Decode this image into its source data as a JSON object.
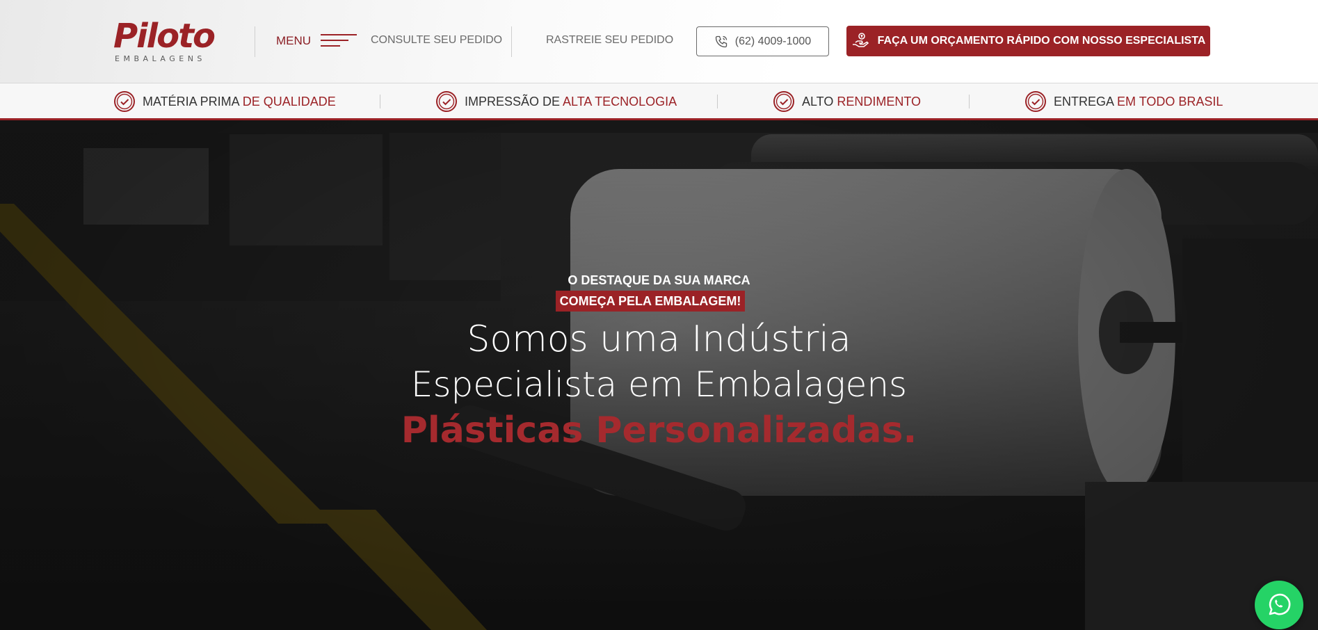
{
  "brand": {
    "name": "Piloto",
    "subtitle": "EMBALAGENS",
    "color": "#9b2226"
  },
  "header": {
    "menu_label": "MENU",
    "nav": [
      {
        "label": "CONSULTE SEU PEDIDO"
      },
      {
        "label": "RASTREIE SEU PEDIDO"
      }
    ],
    "phone": {
      "label": "(62) 4009-1000",
      "icon": "phone-icon"
    },
    "cta": {
      "label": "FAÇA UM ORÇAMENTO RÁPIDO COM NOSSO ESPECIALISTA",
      "icon": "hand-coins-icon"
    }
  },
  "features": [
    {
      "text": "MATÉRIA PRIMA ",
      "highlight": "DE QUALIDADE",
      "icon": "check-circle-icon"
    },
    {
      "text": "IMPRESSÃO DE ",
      "highlight": "ALTA TECNOLOGIA",
      "icon": "check-circle-icon"
    },
    {
      "text": "ALTO ",
      "highlight": "RENDIMENTO",
      "icon": "check-circle-icon"
    },
    {
      "text": "ENTREGA ",
      "highlight": "EM TODO BRASIL",
      "icon": "check-circle-icon"
    }
  ],
  "hero": {
    "eyebrow": "O DESTAQUE DA SUA MARCA",
    "eyebrow_tag": "COMEÇA PELA EMBALAGEM!",
    "line1": "Somos uma Indústria",
    "line2": "Especialista em Embalagens",
    "line3": "Plásticas Personalizadas."
  },
  "whatsapp": {
    "icon": "whatsapp-icon",
    "color": "#25d366"
  }
}
